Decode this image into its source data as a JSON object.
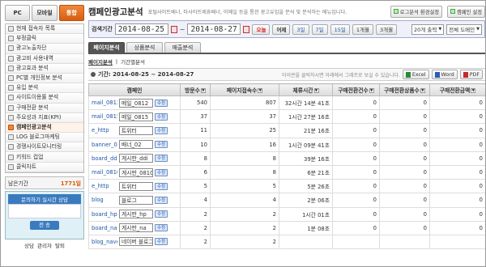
{
  "sidebar": {
    "tabs": [
      {
        "label": "PC"
      },
      {
        "label": "모바일"
      },
      {
        "label": "통합"
      }
    ],
    "items": [
      {
        "label": "현재 접속자 목록"
      },
      {
        "label": "부정클릭"
      },
      {
        "label": "광고노출차단"
      },
      {
        "label": "광고비 사용내역"
      },
      {
        "label": "광고효과 분석"
      },
      {
        "label": "PC별 개인정보 분석"
      },
      {
        "label": "유입 분석"
      },
      {
        "label": "사이트이용률 분석"
      },
      {
        "label": "구매전환 분석"
      },
      {
        "label": "주요성과 지표(KPI)"
      },
      {
        "label": "캠페인광고분석"
      },
      {
        "label": "LOG 블로그마케팅"
      },
      {
        "label": "경쟁사이트모니터링"
      },
      {
        "label": "키워드 컵업"
      },
      {
        "label": "클릭차트"
      }
    ],
    "remain_label": "남은기간",
    "remain_value": "1771일",
    "promo_title": "문의하기 실시간 상담",
    "promo_button": "전 송",
    "bottom_links": [
      {
        "label": "상담"
      },
      {
        "label": "관리자"
      },
      {
        "label": "탈퇴"
      }
    ]
  },
  "header": {
    "title": "캠페인광고분석",
    "description": "포털사이트배너, 타사이트제휴배너, 이메일 등을 통한 광고유입을 분석 및 분석하는 메뉴입니다.",
    "btn_log": "로그분석 환경설정",
    "btn_campaign": "캠페인 설정"
  },
  "filter": {
    "label": "검색기간",
    "date_from": "2014-08-25",
    "date_to": "2014-08-27",
    "quick": [
      {
        "label": "오늘"
      },
      {
        "label": "어제"
      },
      {
        "label": "3일"
      },
      {
        "label": "7일"
      },
      {
        "label": "15일"
      },
      {
        "label": "1개월"
      },
      {
        "label": "3개월"
      }
    ],
    "rows_select": "20개 출력",
    "domain_select": "전체 도메인"
  },
  "tabs": [
    {
      "label": "페이지분석"
    },
    {
      "label": "상품분석"
    },
    {
      "label": "매출분석"
    }
  ],
  "subtabs": [
    {
      "label": "페이지분석"
    },
    {
      "label": "기간별분석"
    }
  ],
  "period": {
    "text": "기간: 2014-08-25 ~ 2014-08-27",
    "note": "아이콘을 클릭하시면 아래에서 그래프로 보실 수 있습니다.",
    "excel": "Excel",
    "word": "Word",
    "pdf": "PDF"
  },
  "table": {
    "headers": [
      "캠페인",
      "방문수",
      "페이지접속수",
      "체류시간",
      "구매전환건수",
      "구매전환상품수",
      "구매전환금액"
    ],
    "button_label": "수정",
    "rows": [
      {
        "id": "mail_0812",
        "name": "메일_0812",
        "visits": "540",
        "pages": "807",
        "stay": "32시간 14분 41초",
        "conv": "0",
        "items": "0",
        "amount": "0"
      },
      {
        "id": "mail_0815",
        "name": "메일_0815",
        "visits": "37",
        "pages": "37",
        "stay": "1시간 27분 16초",
        "conv": "0",
        "items": "0",
        "amount": "0"
      },
      {
        "id": "e_http",
        "name": "트위터",
        "visits": "11",
        "pages": "25",
        "stay": "21분 16초",
        "conv": "0",
        "items": "0",
        "amount": "0"
      },
      {
        "id": "banner_02",
        "name": "배너_02",
        "visits": "10",
        "pages": "16",
        "stay": "1시간 09분 41초",
        "conv": "0",
        "items": "0",
        "amount": "0"
      },
      {
        "id": "board_ddi",
        "name": "게시판_ddi",
        "visits": "8",
        "pages": "8",
        "stay": "39분 16초",
        "conv": "0",
        "items": "0",
        "amount": "0"
      },
      {
        "id": "mail_0810",
        "name": "게시판_0810",
        "visits": "6",
        "pages": "8",
        "stay": "6분 21초",
        "conv": "0",
        "items": "0",
        "amount": "0"
      },
      {
        "id": "e_http",
        "name": "트위터",
        "visits": "5",
        "pages": "5",
        "stay": "5분 26초",
        "conv": "0",
        "items": "0",
        "amount": "0"
      },
      {
        "id": "blog",
        "name": "블로그",
        "visits": "4",
        "pages": "4",
        "stay": "2분 06초",
        "conv": "0",
        "items": "0",
        "amount": "0"
      },
      {
        "id": "board_hp",
        "name": "게시판_hp",
        "visits": "2",
        "pages": "2",
        "stay": "1시간 01초",
        "conv": "0",
        "items": "0",
        "amount": "0"
      },
      {
        "id": "board_na",
        "name": "게시판_na",
        "visits": "2",
        "pages": "2",
        "stay": "1분 08초",
        "conv": "0",
        "items": "0",
        "amount": "0"
      },
      {
        "id": "blog_naver",
        "name": "네이버 블로그",
        "visits": "2",
        "pages": "2",
        "stay": "",
        "conv": "",
        "items": "",
        "amount": ""
      }
    ]
  }
}
